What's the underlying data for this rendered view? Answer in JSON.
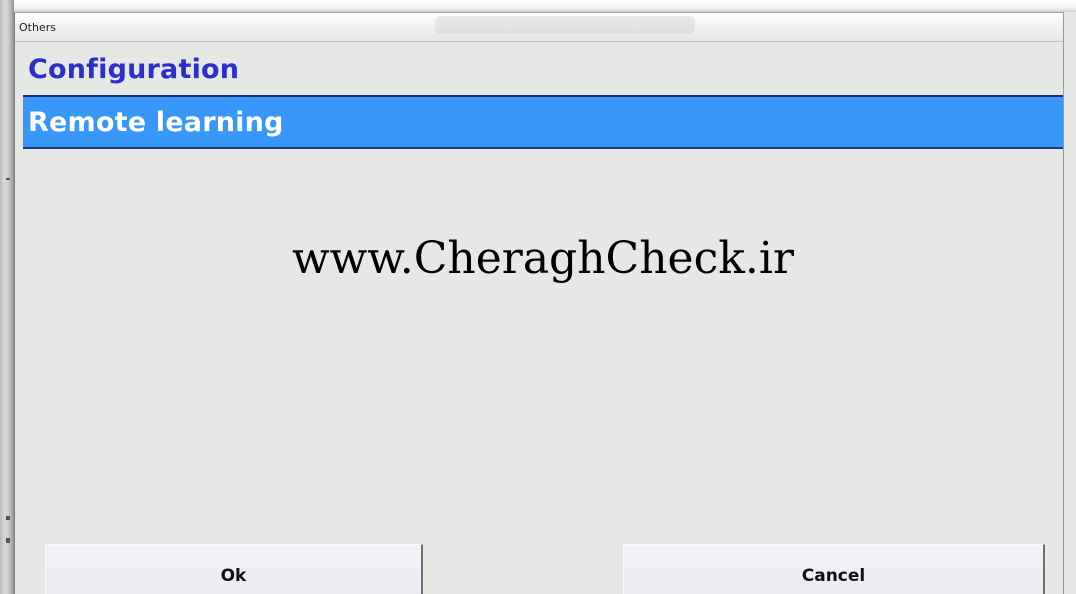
{
  "window": {
    "title": "Others"
  },
  "sections": {
    "configuration": "Configuration",
    "remote_learning": "Remote learning"
  },
  "content": {
    "watermark_text": "www.CheraghCheck.ir"
  },
  "buttons": {
    "ok_label": "Ok",
    "cancel_label": "Cancel"
  },
  "colors": {
    "configuration_text": "#2b2fd0",
    "remote_learning_bg": "#3798fa",
    "window_bg": "#e6e8e6"
  }
}
